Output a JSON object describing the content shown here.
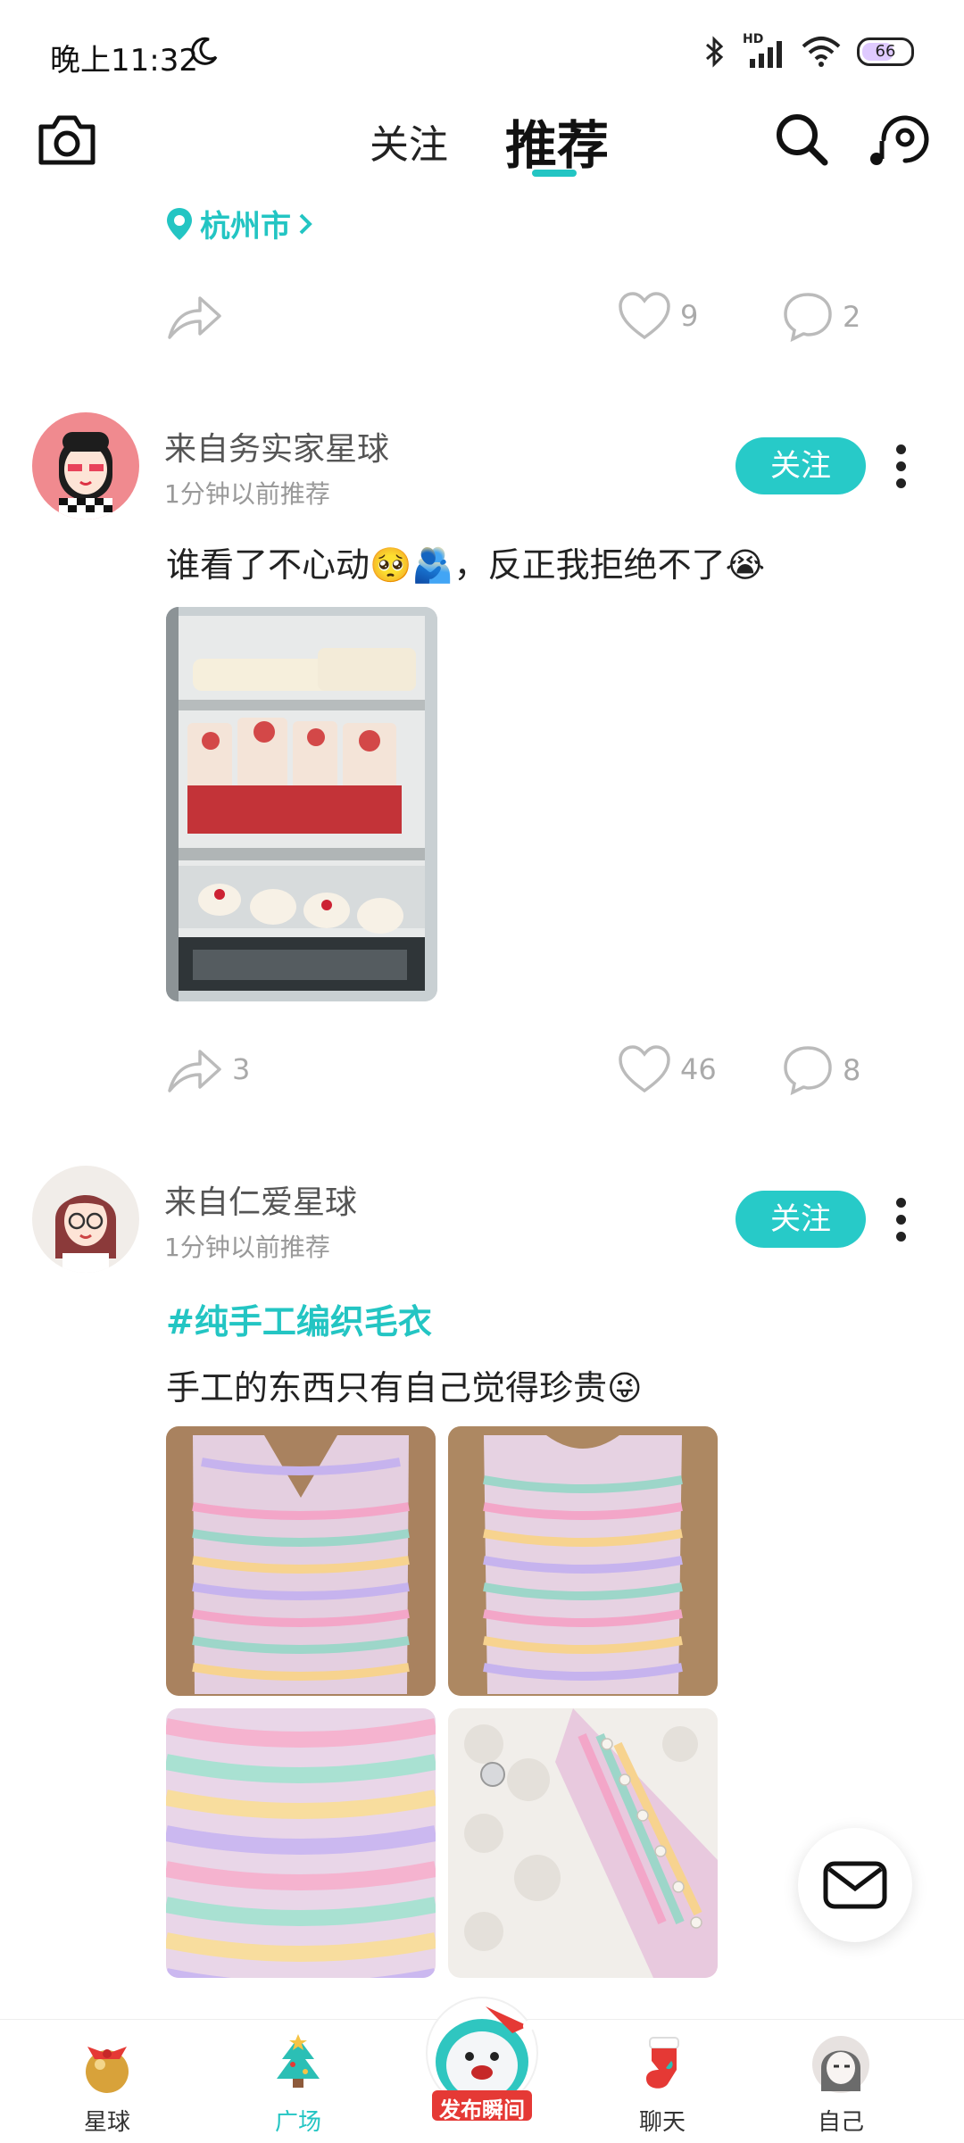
{
  "status_bar": {
    "time": "晚上11:32",
    "battery": "66",
    "network": "HD"
  },
  "top_nav": {
    "tab_follow": "关注",
    "tab_recommend": "推荐"
  },
  "location": "杭州市",
  "post0": {
    "likes": "9",
    "comments": "2"
  },
  "post1": {
    "username": "来自务实家星球",
    "time": "1分钟以前推荐",
    "follow_label": "关注",
    "text": "谁看了不心动🥺🫂，反正我拒绝不了😭",
    "shares": "3",
    "likes": "46",
    "comments": "8"
  },
  "post2": {
    "username": "来自仁爱星球",
    "time": "1分钟以前推荐",
    "follow_label": "关注",
    "hashtag": "#纯手工编织毛衣",
    "text": "手工的东西只有自己觉得珍贵😜"
  },
  "bottom_nav": {
    "planet": "星球",
    "plaza": "广场",
    "publish": "发布瞬间",
    "chat": "聊天",
    "me": "自己"
  },
  "colors": {
    "accent": "#23c5c3"
  }
}
